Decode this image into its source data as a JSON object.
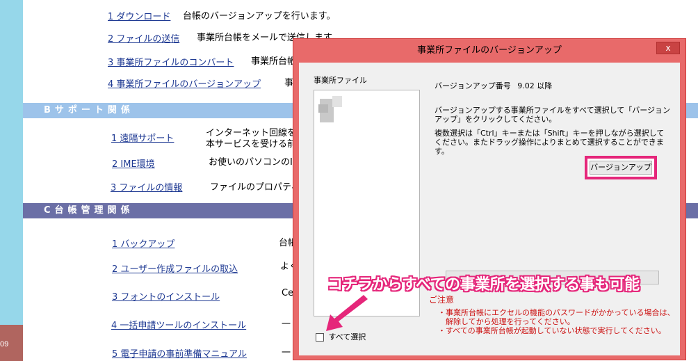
{
  "background": {
    "side_number": "09",
    "items_a": [
      {
        "link": "1 ダウンロード",
        "desc": "台帳のバージョンアップを行います。"
      },
      {
        "link": "2 ファイルの送信",
        "desc": "事業所台帳をメールで送信します。"
      },
      {
        "link": "3 事業所ファイルのコンバート",
        "desc": "事業所台帳"
      },
      {
        "link": "4 事業所ファイルのバージョンアップ",
        "desc": "事"
      }
    ],
    "section_b": "Bサポート関係",
    "items_b": [
      {
        "link": "1 遠隔サポート",
        "desc1": "インターネット回線を利",
        "desc2": "本サービスを受ける前1"
      },
      {
        "link": "2 IME環境",
        "desc": "お使いのパソコンのIM"
      },
      {
        "link": "3 ファイルの情報",
        "desc": "ファイルのプロパティを"
      }
    ],
    "section_c": "C台帳管理関係",
    "items_c": [
      {
        "link": "1 バックアップ",
        "desc": "台帳"
      },
      {
        "link": "2 ユーザー作成ファイルの取込",
        "desc": "よく"
      },
      {
        "link": "3 フォントのインストール",
        "desc": "Ce"
      },
      {
        "link": "4 一括申請ツールのインストール",
        "desc": "一"
      },
      {
        "link": "5 電子申請の事前準備マニュアル",
        "desc": "一"
      }
    ]
  },
  "dialog": {
    "title": "事業所ファイルのバージョンアップ",
    "close_glyph": "x",
    "list_label": "事業所ファイル",
    "version_label": "バージョンアップ番号",
    "version_value": "9.02 以降",
    "instruction1": "バージョンアップする事業所ファイルをすべて選択して「バージョンアップ」をクリックしてください。",
    "instruction2": "複数選択は「Ctrl」キーまたは「Shift」キーを押しながら選択してください。またドラッグ操作によりまとめて選択することができます。",
    "upgrade_button": "バージョンアップ",
    "notice_title": "ご注意",
    "notices": [
      "・事業所台帳にエクセルの機能のパスワードがかかっている場合は、",
      "　解除してから処理を行ってください。",
      "・すべての事業所台帳が起動していない状態で実行してください。"
    ],
    "select_all_label": "すべて選択",
    "select_all_checked": false
  },
  "annotation": {
    "text": "コチラからすべての事業所を選択する事も可能",
    "color": "#e5267a"
  },
  "colors": {
    "left_strip": "#96d7ea",
    "section_b": "#9dc3ea",
    "section_c": "#6b6fa6",
    "dialog_frame": "#e86a6a",
    "highlight": "#e5267a",
    "notice_text": "#cc1111"
  }
}
